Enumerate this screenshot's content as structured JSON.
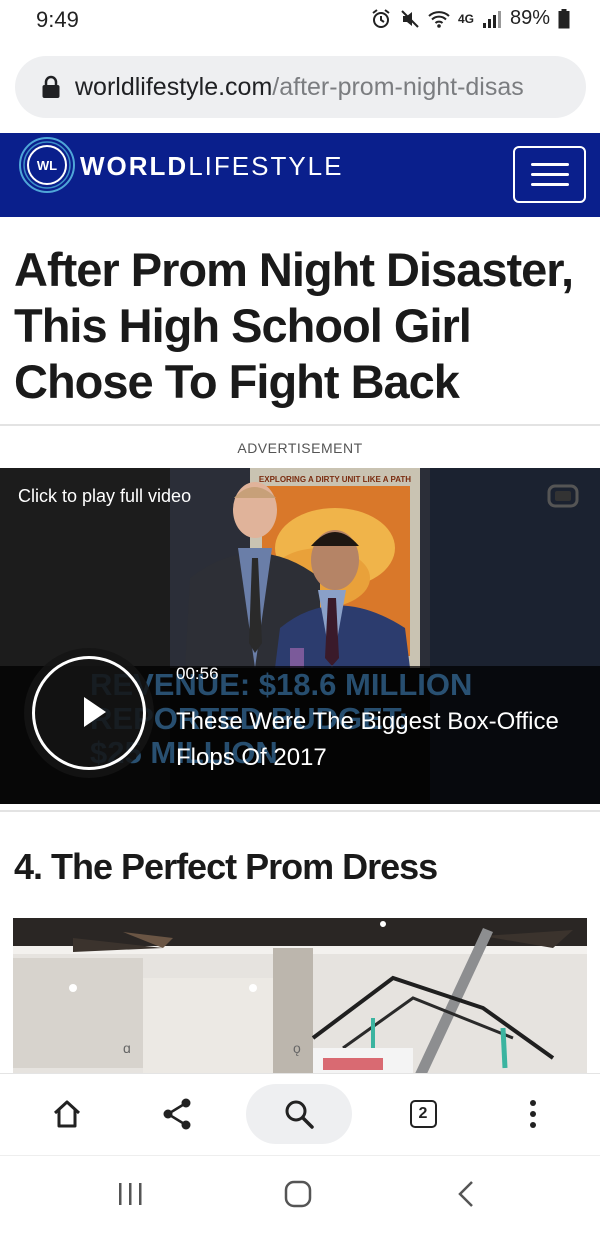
{
  "status": {
    "time": "9:49",
    "network": "4G",
    "battery": "89%"
  },
  "browser": {
    "url_domain": "worldlifestyle.com",
    "url_path": "/after-prom-night-disas",
    "tab_count": "2"
  },
  "site": {
    "logo_badge": "WL",
    "logo_bold": "WORLD",
    "logo_light": "LIFESTYLE"
  },
  "article": {
    "headline": "After Prom Night Disaster, This High School Girl Chose To Fight Back",
    "ad_label": "ADVERTISEMENT",
    "section_title": "4. The Perfect Prom Dress"
  },
  "video": {
    "click_label": "Click to play full video",
    "duration": "00:56",
    "title": "These Were The Biggest Box-Office Flops Of 2017",
    "bg_line1": "REVENUE: $18.6 MILLION",
    "bg_line2": "REPORTED BUDGET:",
    "bg_line3": "$25 MILLION",
    "poster_text": "EXPLORING A DIRTY UNIT LIKE A PATH"
  },
  "icons": {
    "home": "home-icon",
    "share": "share-icon",
    "search": "search-icon",
    "tabs": "tabs-icon",
    "more": "more-vertical-icon",
    "recents": "recents-icon",
    "nav_home": "nav-home-icon",
    "back": "back-icon"
  },
  "colors": {
    "header_bg": "#0a1f8c",
    "accent": "#0a1f8c"
  }
}
